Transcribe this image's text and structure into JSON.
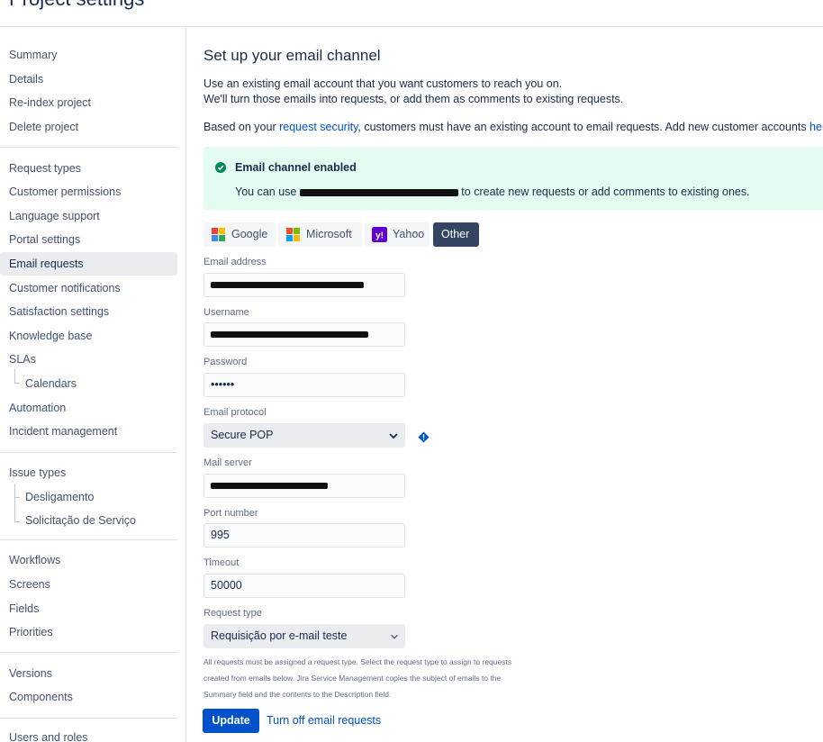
{
  "page": {
    "title": "Project settings"
  },
  "sidebar": {
    "items": [
      "Summary",
      "Details",
      "Re-index project",
      "Delete project",
      "Request types",
      "Customer permissions",
      "Language support",
      "Portal settings",
      "Email requests",
      "Customer notifications",
      "Satisfaction settings",
      "Knowledge base",
      "SLAs",
      "Calendars",
      "Automation",
      "Incident management",
      "Issue types",
      "Desligamento",
      "Solicitação de Serviço",
      "Workflows",
      "Screens",
      "Fields",
      "Priorities",
      "Versions",
      "Components",
      "Users and roles"
    ]
  },
  "main": {
    "heading": "Set up your email channel",
    "intro_line1": "Use an existing email account that you want customers to reach you on.",
    "intro_line2": "We'll turn those emails into requests, or add them as comments to existing requests.",
    "security_prefix": "Based on your ",
    "security_link": "request security",
    "security_suffix": ", customers must have an existing account to email requests. Add new customer accounts ",
    "security_link2": "her",
    "banner": {
      "title": "Email channel enabled",
      "text_prefix": "You can use ",
      "text_suffix": " to create new requests or add comments to existing ones."
    },
    "providers": [
      "Google",
      "Microsoft",
      "Yahoo",
      "Other"
    ],
    "form": {
      "email_label": "Email address",
      "username_label": "Username",
      "password_label": "Password",
      "password_value": "••••••",
      "protocol_label": "Email protocol",
      "protocol_value": "Secure POP",
      "server_label": "Mail server",
      "port_label": "Port number",
      "port_value": "995",
      "timeout_label": "Timeout",
      "timeout_value": "50000",
      "request_type_label": "Request type",
      "request_type_value": "Requisição por e-mail teste"
    },
    "help_line1": "All requests must be assigned a request type. Select the request type to assign to requests",
    "help_line2": "created from emails below. Jira Service Management copies the subject of emails to the",
    "help_line3": "Summary field and the contents to the Description field.",
    "update_label": "Update",
    "turn_off_label": "Turn off email requests"
  },
  "colors": {
    "primary": "#0052cc",
    "success_bg": "#e3fcef",
    "success_icon": "#00875a",
    "active_tab": "#344563"
  },
  "icons": {
    "success": "check-circle-icon",
    "warning": "info-icon",
    "chevron": "chevron-down-icon"
  }
}
